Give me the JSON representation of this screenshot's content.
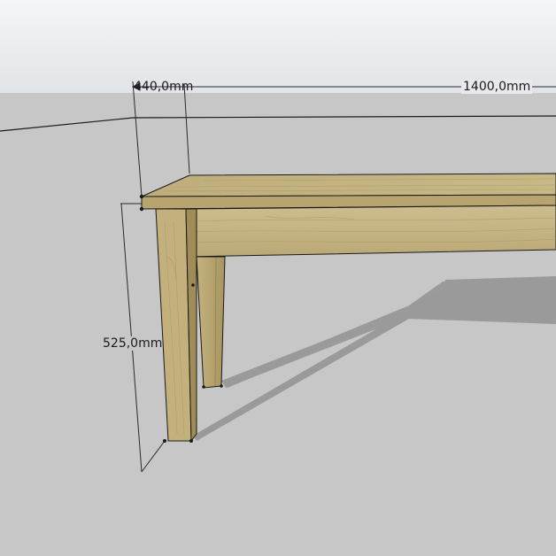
{
  "dimensions": {
    "depth": "440,0mm",
    "length": "1400,0mm",
    "height": "525,0mm"
  },
  "colors": {
    "sky_top": "#f4f5f7",
    "sky_bottom": "#e3e6ea",
    "ground": "#c7c7c7",
    "shadow": "#9a9a9a",
    "wood_light": "#c9b98a",
    "wood_mid": "#b8a570",
    "wood_dark": "#8f7f4f",
    "edge": "#1a1a1a"
  }
}
